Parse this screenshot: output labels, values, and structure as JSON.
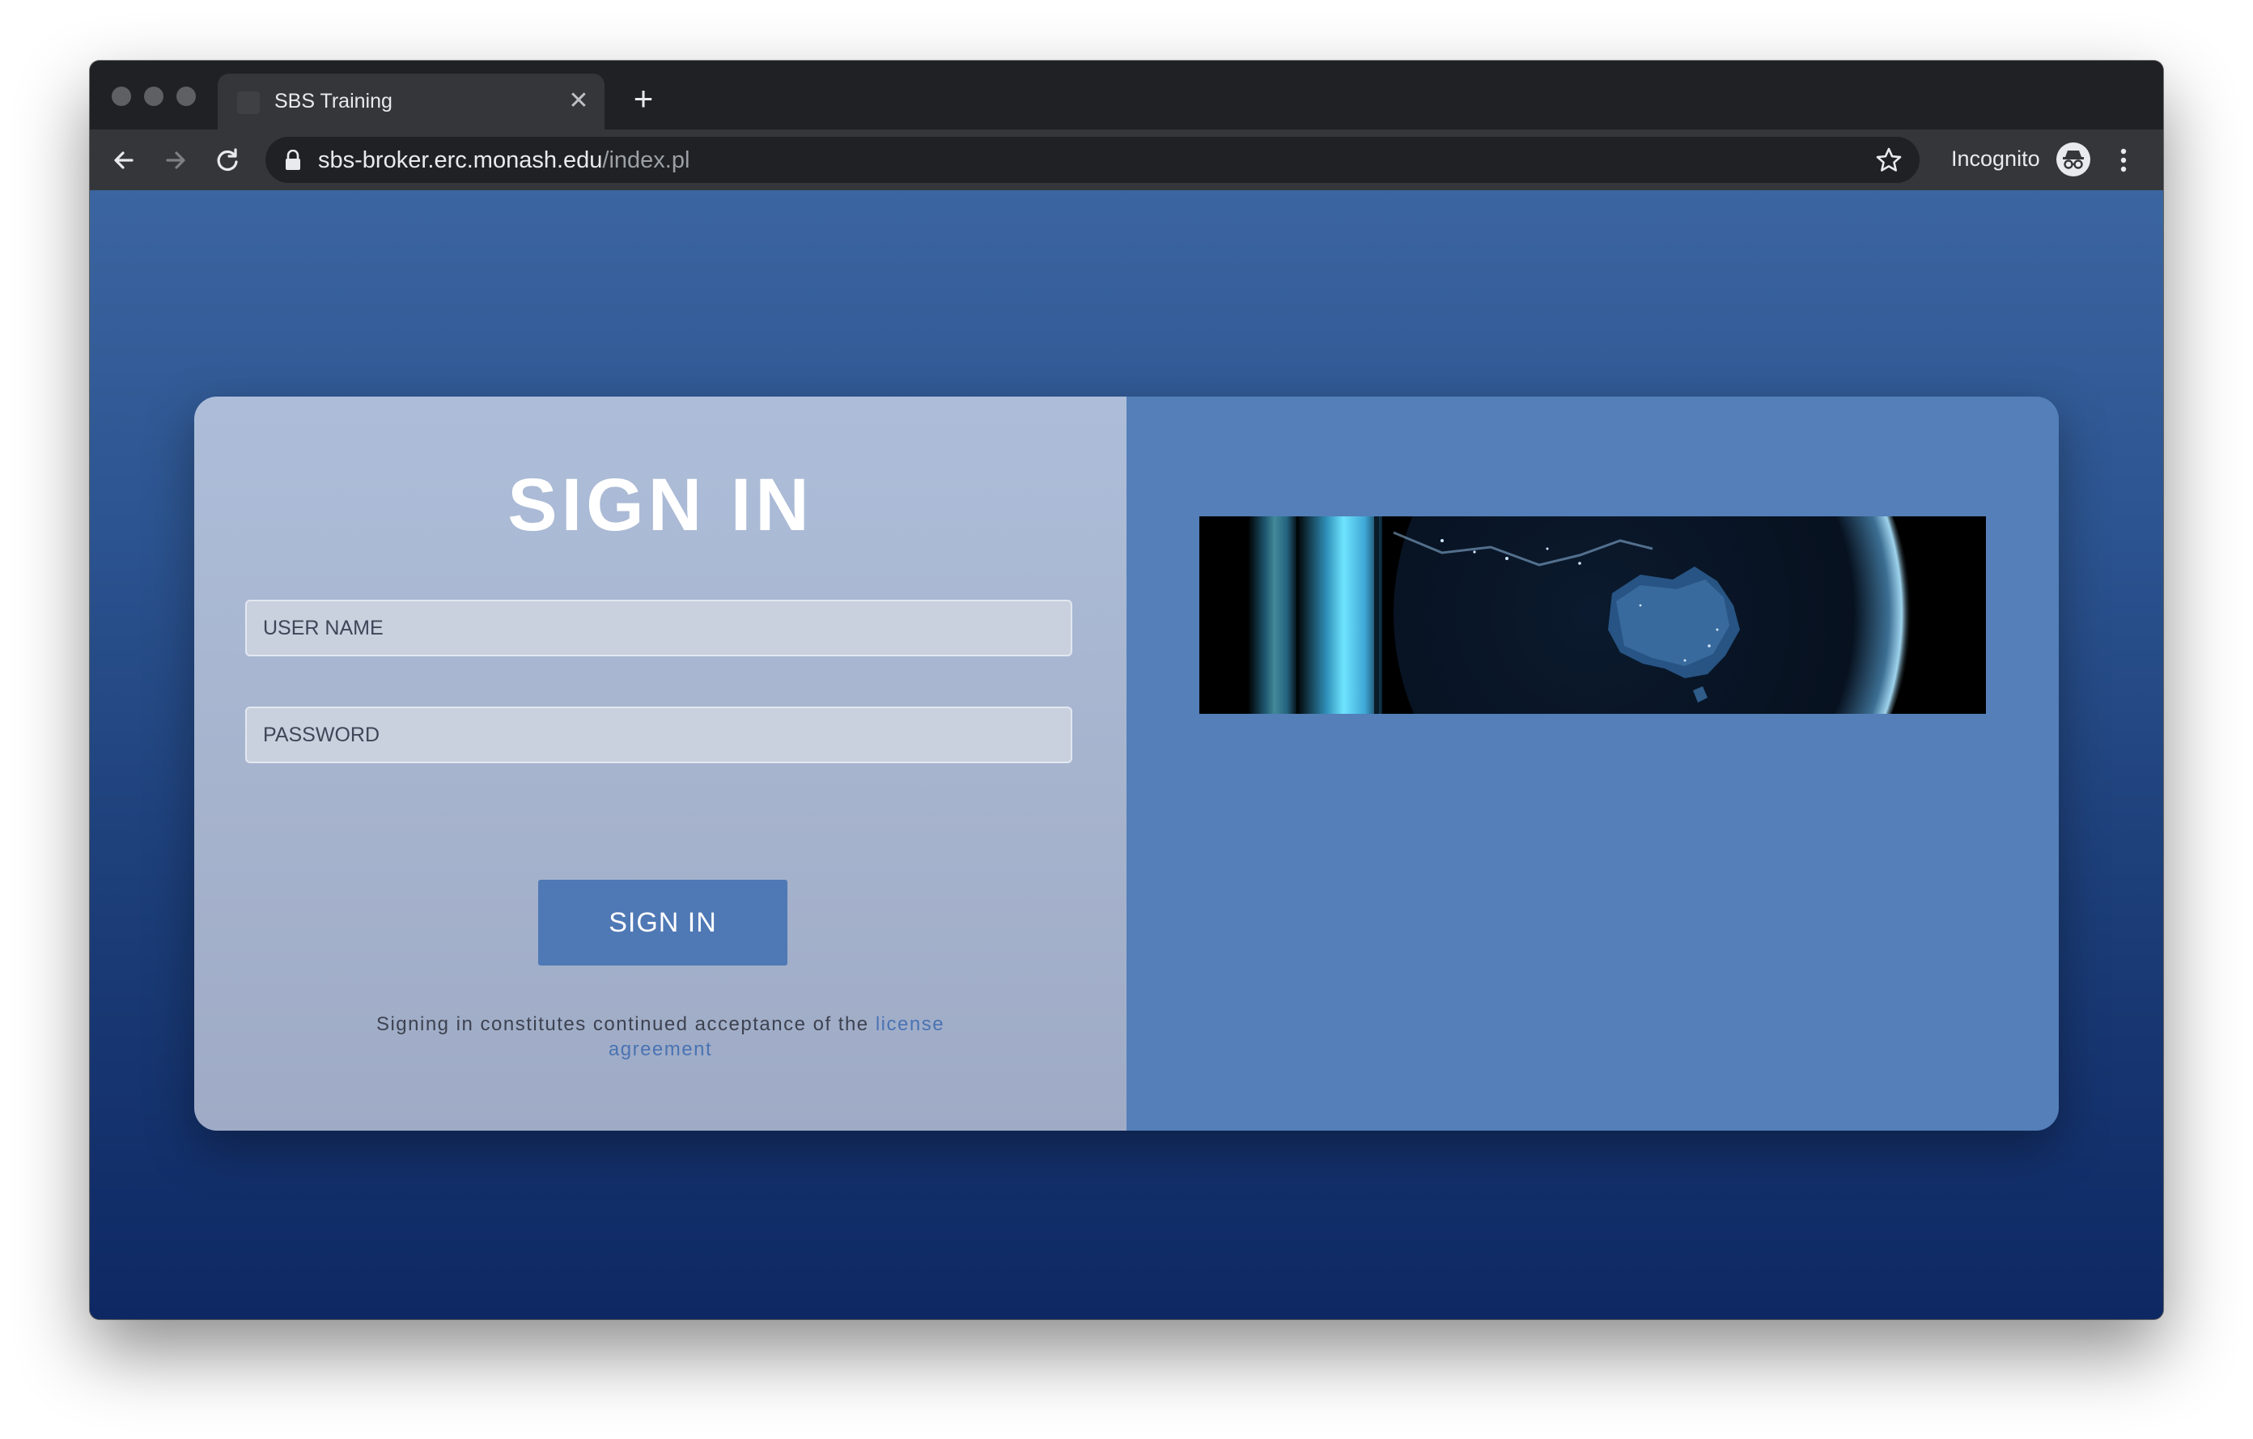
{
  "browser": {
    "tab_title": "SBS Training",
    "tab_close_icon": "close-icon",
    "new_tab_icon": "plus-icon",
    "url_host": "sbs-broker.erc.monash.edu",
    "url_path": "/index.pl",
    "profile_label": "Incognito",
    "icons": {
      "back": "arrow-left-icon",
      "forward": "arrow-right-icon",
      "reload": "reload-icon",
      "lock": "lock-icon",
      "bookmark": "star-icon",
      "profile": "incognito-icon",
      "menu": "kebab-menu-icon"
    }
  },
  "page": {
    "title": "SIGN IN",
    "username_placeholder": "USER NAME",
    "username_value": "",
    "password_placeholder": "PASSWORD",
    "password_value": "",
    "submit_label": "SIGN IN",
    "license_text": "Signing in constitutes continued acceptance of the ",
    "license_link": "license agreement",
    "banner_image": "earth-at-night-australia"
  },
  "colors": {
    "page_gradient_top": "#3b65a0",
    "page_gradient_bottom": "#0e2863",
    "card_left": "#adbdd9",
    "card_right": "#547fb8",
    "button": "#4f79b5",
    "link": "#4a73b3"
  }
}
